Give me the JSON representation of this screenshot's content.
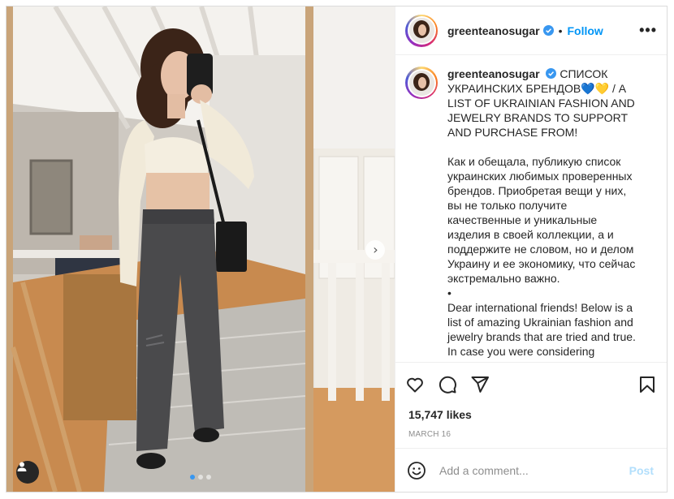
{
  "post": {
    "username": "greenteanosugar",
    "separator": "•",
    "follow_label": "Follow",
    "more_label": "•••"
  },
  "caption": {
    "username": "greenteanosugar",
    "heading_ru": "СПИСОК УКРАИНСКИХ БРЕНДОВ",
    "hearts": "💙💛",
    "heading_en": " / A LIST OF UKRAINIAN FASHION AND JEWELRY BRANDS TO SUPPORT AND PURCHASE FROM!",
    "paragraph_ru": "Как и обещала, публикую список украинских любимых проверенных брендов. Приобретая вещи у них, вы не только получите качественные и уникальные изделия в своей коллекции, а и поддержите не словом, но и делом Украину и ее экономику, что сейчас экстремально важно.",
    "bullet": "•",
    "paragraph_en": "Dear international friends! Below is a list of amazing Ukrainian fashion and jewelry brands that are tried and true. In case you were considering"
  },
  "stats": {
    "likes": "15,747 likes",
    "date": "MARCH 16"
  },
  "comment": {
    "placeholder": "Add a comment...",
    "post_label": "Post"
  },
  "icons": {
    "like": "heart-icon",
    "comment": "comment-icon",
    "share": "share-icon",
    "save": "bookmark-icon",
    "emoji": "emoji-icon",
    "next": "chevron-right-icon",
    "tag": "user-tag-icon"
  },
  "carousel": {
    "count": 3,
    "active": 1
  },
  "colors": {
    "accent": "#0095f6",
    "verified": "#3897f0",
    "text": "#262626",
    "muted": "#8e8e8e",
    "post_disabled": "#b2dffc"
  }
}
